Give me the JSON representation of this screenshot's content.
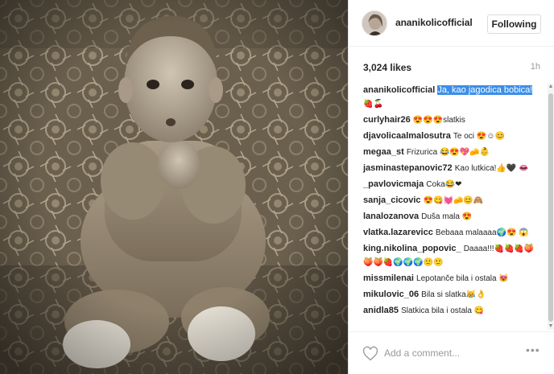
{
  "post": {
    "username": "ananikolicofficial",
    "follow_label": "Following",
    "likes": "3,024 likes",
    "time": "1h"
  },
  "comments": [
    {
      "user": "ananikolicofficial",
      "pre": "",
      "selected": "Ja, kao jagodica bobica!",
      "text": "",
      "emoji": "🍓🍒"
    },
    {
      "user": "curlyhair26",
      "pre": "",
      "selected": "",
      "text": "😍😍😍slatkis",
      "emoji": ""
    },
    {
      "user": "djavolicaalmalosutra",
      "pre": "",
      "selected": "",
      "text": "Te oci 😍☺😊",
      "emoji": ""
    },
    {
      "user": "megaa_st",
      "pre": "",
      "selected": "",
      "text": "Frizurica 😂😍💖🧀👶",
      "emoji": ""
    },
    {
      "user": "jasminastepanovic72",
      "pre": "",
      "selected": "",
      "text": "Kao lutkica!👍🖤 👄",
      "emoji": ""
    },
    {
      "user": "_pavlovicmaja",
      "pre": "",
      "selected": "",
      "text": "Coka😂❤",
      "emoji": ""
    },
    {
      "user": "sanja_cicovic",
      "pre": "",
      "selected": "",
      "text": "😍😋💓🧀😊🙈",
      "emoji": ""
    },
    {
      "user": "lanalozanova",
      "pre": "",
      "selected": "",
      "text": "Duša mala 😍",
      "emoji": ""
    },
    {
      "user": "vlatka.lazarevicc",
      "pre": "",
      "selected": "",
      "text": "Bebaaa malaaaa🌍😍 😱",
      "emoji": ""
    },
    {
      "user": "king.nikolina_popovic_",
      "pre": "",
      "selected": "",
      "text": "Daaaa!!!🍓🍓🍓🍑🍑🍑🍓🌍🌍🌍🙂🙂",
      "emoji": ""
    },
    {
      "user": "missmilenai",
      "pre": "",
      "selected": "",
      "text": "Lepotanče bila i ostala 😻",
      "emoji": ""
    },
    {
      "user": "mikulovic_06",
      "pre": "",
      "selected": "",
      "text": "Bila si slatka😹👌",
      "emoji": ""
    },
    {
      "user": "anidla85",
      "pre": "",
      "selected": "",
      "text": "Slatkica bila i ostala 😋",
      "emoji": ""
    }
  ],
  "footer": {
    "placeholder": "Add a comment...",
    "more": "•••"
  },
  "icons": {
    "heart": "heart-icon",
    "more": "more-options-icon"
  }
}
